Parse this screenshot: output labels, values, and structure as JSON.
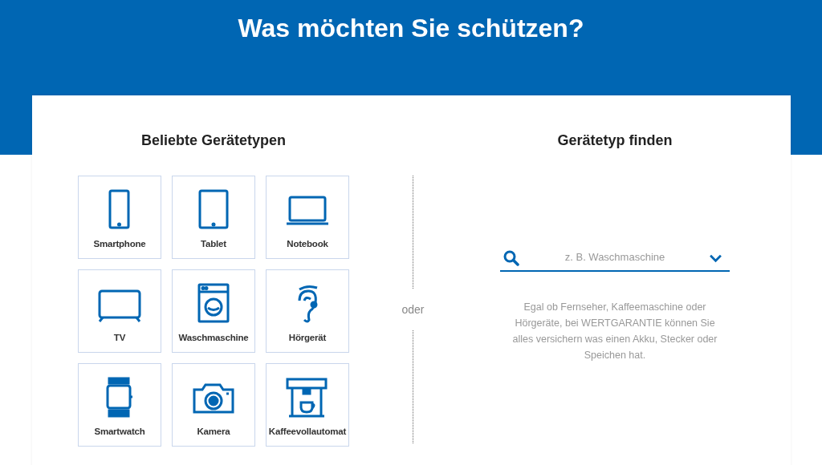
{
  "header": {
    "title": "Was möchten Sie schützen?"
  },
  "popular": {
    "heading": "Beliebte Gerätetypen",
    "tiles": [
      {
        "label": "Smartphone"
      },
      {
        "label": "Tablet"
      },
      {
        "label": "Notebook"
      },
      {
        "label": "TV"
      },
      {
        "label": "Waschmaschine"
      },
      {
        "label": "Hörgerät"
      },
      {
        "label": "Smartwatch"
      },
      {
        "label": "Kamera"
      },
      {
        "label": "Kaffeevollautomat"
      }
    ]
  },
  "divider": {
    "label": "oder"
  },
  "finder": {
    "heading": "Gerätetyp finden",
    "search": {
      "placeholder": "z. B. Waschmaschine"
    },
    "description": "Egal ob Fernseher, Kaffeemaschine oder Hörgeräte, bei WERTGARANTIE können Sie alles versichern was einen Akku, Stecker oder Speichen hat."
  }
}
